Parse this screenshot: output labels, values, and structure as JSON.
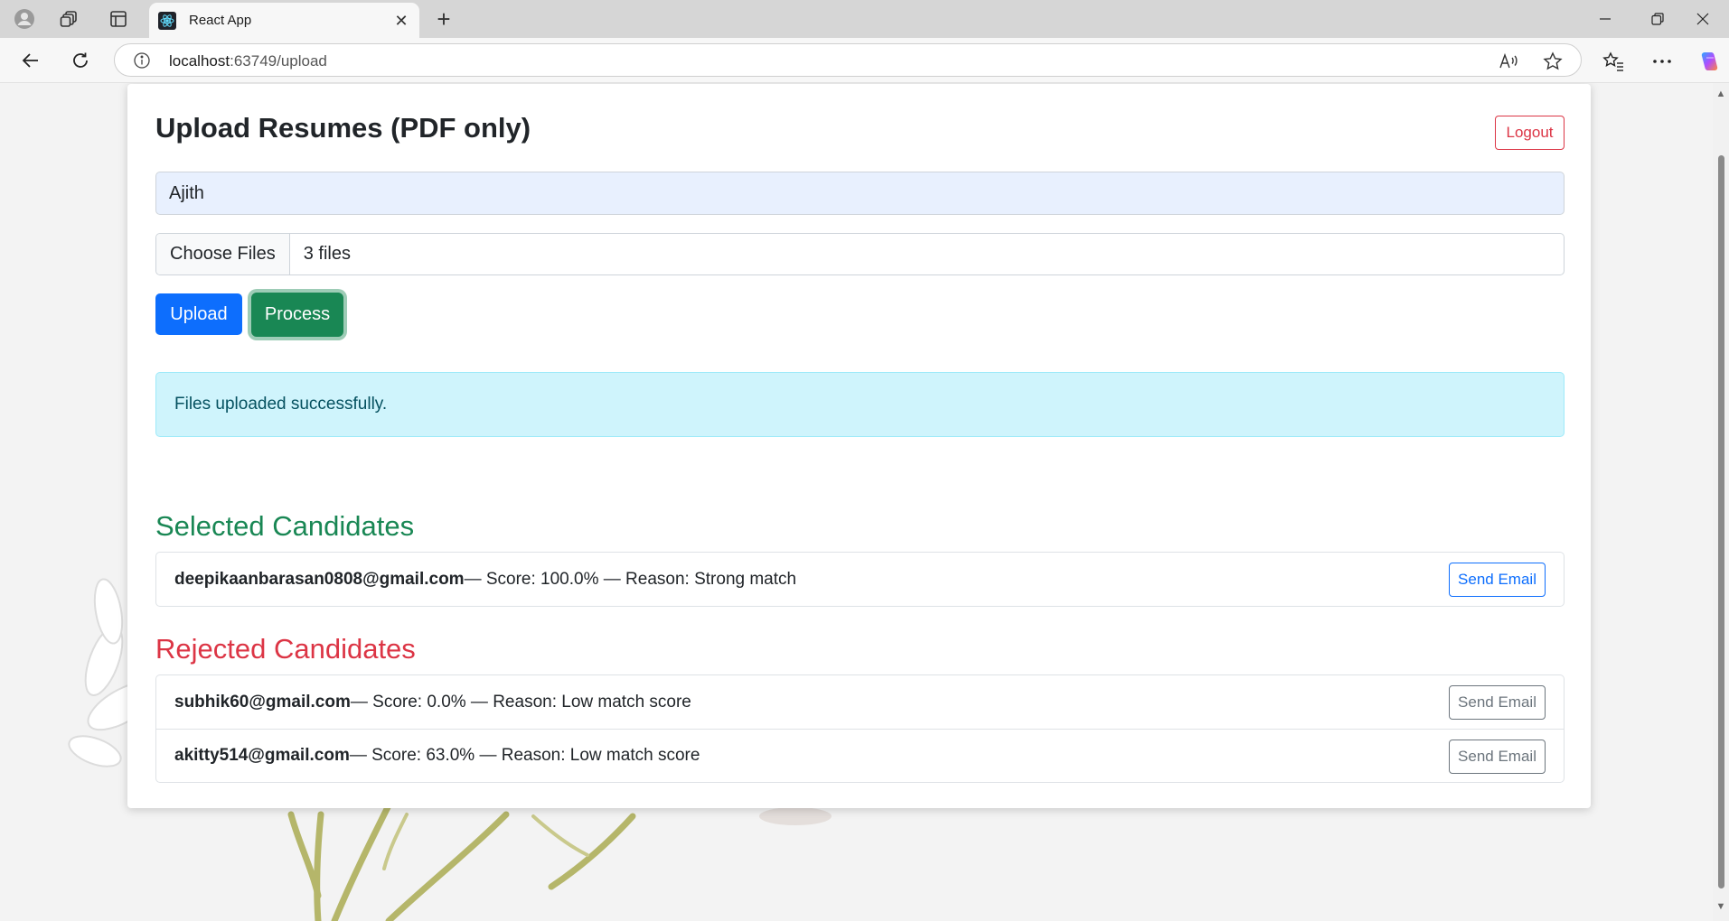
{
  "browser": {
    "tab_title": "React App",
    "url_host": "localhost",
    "url_rest": ":63749/upload"
  },
  "page": {
    "title": "Upload Resumes (PDF only)",
    "logout_label": "Logout",
    "name_value": "Ajith",
    "choose_files_label": "Choose Files",
    "files_selected": "3 files",
    "upload_label": "Upload",
    "process_label": "Process",
    "alert_text": "Files uploaded successfully."
  },
  "selected": {
    "heading": "Selected Candidates",
    "items": [
      {
        "email": "deepikaanbarasan0808@gmail.com",
        "detail": " — Score: 100.0% — Reason: Strong match",
        "button": "Send Email"
      }
    ]
  },
  "rejected": {
    "heading": "Rejected Candidates",
    "items": [
      {
        "email": "subhik60@gmail.com",
        "detail": " — Score: 0.0% — Reason: Low match score",
        "button": "Send Email"
      },
      {
        "email": "akitty514@gmail.com",
        "detail": " — Score: 63.0% — Reason: Low match score",
        "button": "Send Email"
      }
    ]
  },
  "colors": {
    "primary": "#0d6efd",
    "success": "#198754",
    "danger": "#dc3545",
    "info_bg": "#cff4fc"
  }
}
